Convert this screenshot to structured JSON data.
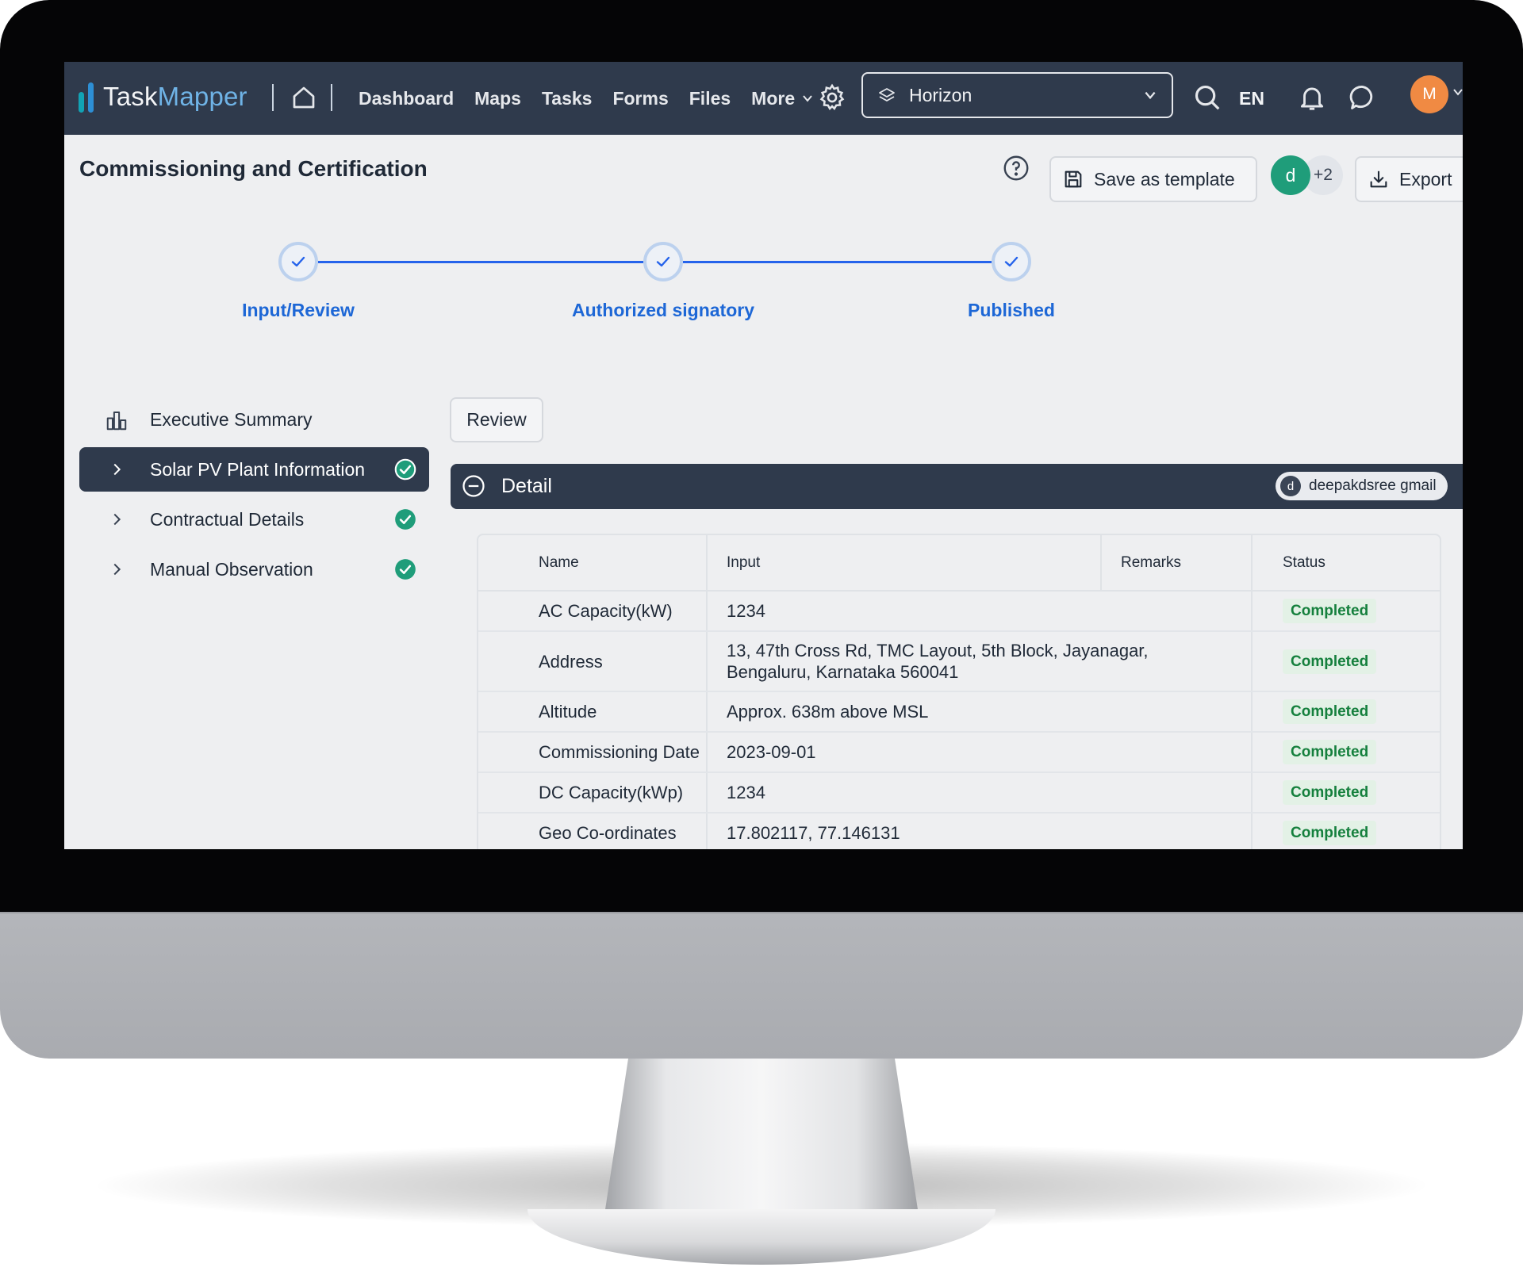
{
  "app": {
    "logo_part1": "Task",
    "logo_part2": "Mapper"
  },
  "nav": {
    "items": [
      "Dashboard",
      "Maps",
      "Tasks",
      "Forms",
      "Files",
      "More"
    ],
    "workspace": "Horizon",
    "language": "EN",
    "user_initial": "M"
  },
  "header": {
    "title": "Commissioning and Certification",
    "save_template": "Save as template",
    "export": "Export",
    "collaborator_initial": "d",
    "collaborator_more": "+2"
  },
  "stepper": {
    "steps": [
      {
        "label": "Input/Review",
        "done": true
      },
      {
        "label": "Authorized signatory",
        "done": true
      },
      {
        "label": "Published",
        "done": true
      }
    ]
  },
  "sidebar": {
    "items": [
      {
        "label": "Executive Summary",
        "icon": "bar-chart-icon"
      },
      {
        "label": "Solar PV Plant Information",
        "completed": true,
        "active": true
      },
      {
        "label": "Contractual Details",
        "completed": true
      },
      {
        "label": "Manual Observation",
        "completed": true
      }
    ]
  },
  "main": {
    "review_button": "Review",
    "section_title": "Detail",
    "owner_initial": "d",
    "owner_name": "deepakdsree gmail",
    "table": {
      "headers": [
        "Name",
        "Input",
        "Remarks",
        "Status"
      ],
      "rows": [
        {
          "name": "AC Capacity(kW)",
          "input": "1234",
          "remarks": "",
          "status": "Completed"
        },
        {
          "name": "Address",
          "input": "13, 47th Cross Rd, TMC Layout, 5th Block, Jayanagar, Bengaluru, Karnataka 560041",
          "remarks": "",
          "status": "Completed"
        },
        {
          "name": "Altitude",
          "input": "Approx. 638m above MSL",
          "remarks": "",
          "status": "Completed"
        },
        {
          "name": "Commissioning Date",
          "input": "2023-09-01",
          "remarks": "",
          "status": "Completed"
        },
        {
          "name": "DC Capacity(kWp)",
          "input": "1234",
          "remarks": "",
          "status": "Completed"
        },
        {
          "name": "Geo Co-ordinates",
          "input": "17.802117, 77.146131",
          "remarks": "",
          "status": "Completed"
        }
      ]
    }
  },
  "colors": {
    "topbar": "#2f3a4c",
    "accent": "#1d67d6",
    "success": "#15803d",
    "avatar_user": "#f08a43",
    "avatar_collab": "#1f9d7a"
  }
}
